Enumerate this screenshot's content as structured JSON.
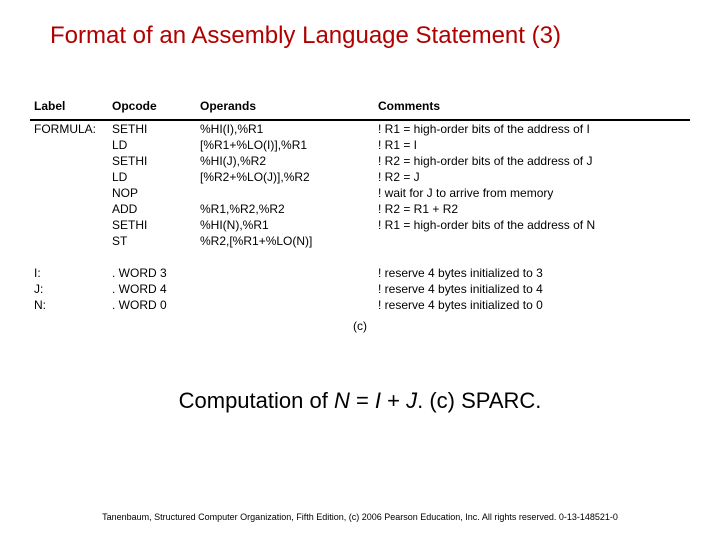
{
  "title": "Format of an Assembly Language Statement (3)",
  "headers": {
    "label": "Label",
    "opcode": "Opcode",
    "operands": "Operands",
    "comments": "Comments"
  },
  "rows": {
    "r0": {
      "label": "FORMULA:",
      "opcode": "SETHI",
      "operands": "%HI(I),%R1",
      "comment": "! R1 = high-order bits of the address of I"
    },
    "r1": {
      "label": "",
      "opcode": "LD",
      "operands": "[%R1+%LO(I)],%R1",
      "comment": "! R1 = I"
    },
    "r2": {
      "label": "",
      "opcode": "SETHI",
      "operands": "%HI(J),%R2",
      "comment": "! R2 = high-order bits of the address of J"
    },
    "r3": {
      "label": "",
      "opcode": "LD",
      "operands": "[%R2+%LO(J)],%R2",
      "comment": "! R2 = J"
    },
    "r4": {
      "label": "",
      "opcode": "NOP",
      "operands": "",
      "comment": "! wait for J to arrive from memory"
    },
    "r5": {
      "label": "",
      "opcode": "ADD",
      "operands": "%R1,%R2,%R2",
      "comment": "! R2 = R1 + R2"
    },
    "r6": {
      "label": "",
      "opcode": "SETHI",
      "operands": "%HI(N),%R1",
      "comment": "! R1 = high-order bits of the address of N"
    },
    "r7": {
      "label": "",
      "opcode": "ST",
      "operands": "%R2,[%R1+%LO(N)]",
      "comment": ""
    },
    "d0": {
      "label": "I:",
      "opcode": ". WORD 3",
      "operands": "",
      "comment": "! reserve 4 bytes initialized to 3"
    },
    "d1": {
      "label": "J:",
      "opcode": ". WORD 4",
      "operands": "",
      "comment": "! reserve 4 bytes initialized to 4"
    },
    "d2": {
      "label": "N:",
      "opcode": ". WORD 0",
      "operands": "",
      "comment": "! reserve 4 bytes initialized to 0"
    }
  },
  "fig_letter": "(c)",
  "caption": {
    "pre": "Computation of ",
    "n": "N",
    "eq": " = ",
    "i": "I",
    "plus": " + ",
    "j": "J",
    "post": ".   (c) SPARC."
  },
  "footer": "Tanenbaum, Structured Computer Organization, Fifth Edition, (c) 2006 Pearson Education, Inc. All rights reserved. 0-13-148521-0"
}
